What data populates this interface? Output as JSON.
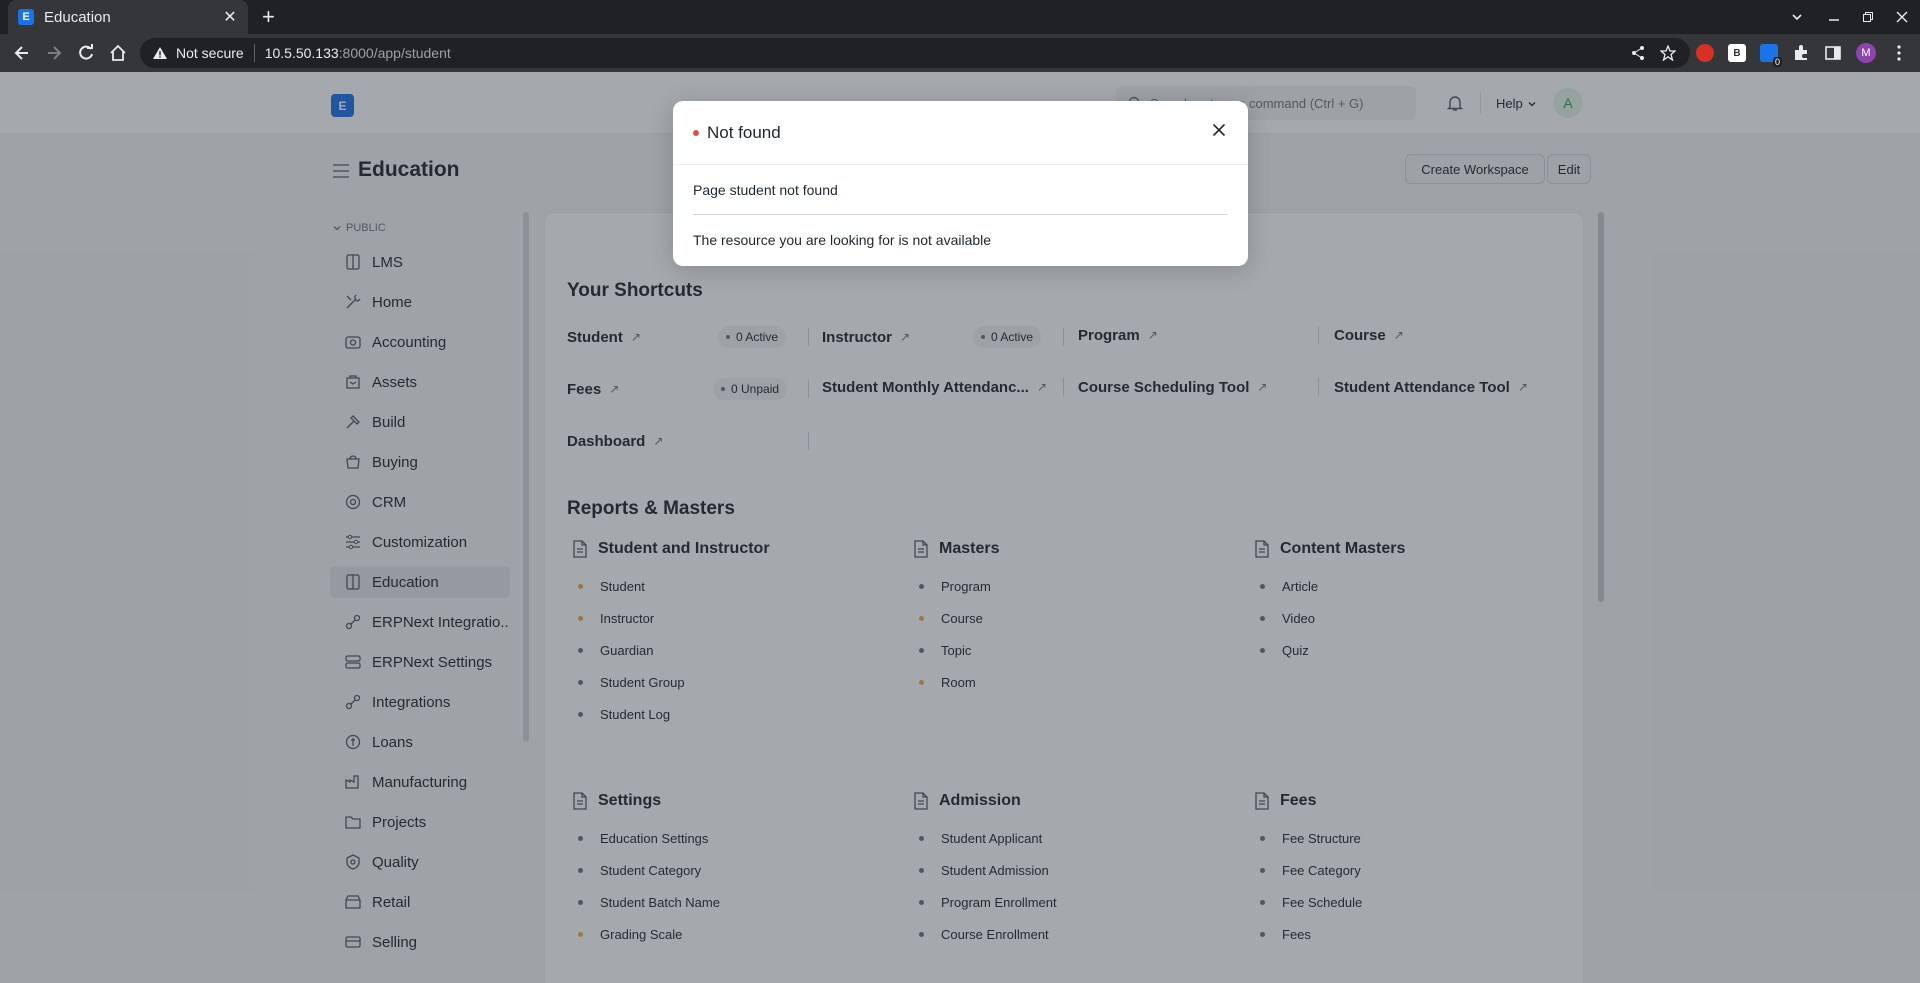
{
  "browser": {
    "tab_title": "Education",
    "tab_favicon": "E",
    "security_label": "Not secure",
    "url_host": "10.5.50.133",
    "url_rest": ":8000/app/student",
    "profile_initial": "M",
    "ext_badge": "0"
  },
  "navbar": {
    "logo": "E",
    "search_placeholder": "Search or type a command (Ctrl + G)",
    "help_label": "Help",
    "avatar_initial": "A"
  },
  "page": {
    "title": "Education",
    "create_workspace": "Create Workspace",
    "edit": "Edit"
  },
  "sidebar": {
    "section": "PUBLIC",
    "items": [
      {
        "label": "LMS",
        "icon": "book-icon"
      },
      {
        "label": "Home",
        "icon": "tools-icon"
      },
      {
        "label": "Accounting",
        "icon": "accounting-icon"
      },
      {
        "label": "Assets",
        "icon": "assets-icon"
      },
      {
        "label": "Build",
        "icon": "build-icon"
      },
      {
        "label": "Buying",
        "icon": "buying-icon"
      },
      {
        "label": "CRM",
        "icon": "crm-icon"
      },
      {
        "label": "Customization",
        "icon": "sliders-icon"
      },
      {
        "label": "Education",
        "icon": "book-icon"
      },
      {
        "label": "ERPNext Integratio...",
        "icon": "integration-icon"
      },
      {
        "label": "ERPNext Settings",
        "icon": "settings-icon"
      },
      {
        "label": "Integrations",
        "icon": "integration-icon"
      },
      {
        "label": "Loans",
        "icon": "loans-icon"
      },
      {
        "label": "Manufacturing",
        "icon": "factory-icon"
      },
      {
        "label": "Projects",
        "icon": "folder-icon"
      },
      {
        "label": "Quality",
        "icon": "quality-icon"
      },
      {
        "label": "Retail",
        "icon": "retail-icon"
      },
      {
        "label": "Selling",
        "icon": "selling-icon"
      }
    ]
  },
  "shortcuts": {
    "title": "Your Shortcuts",
    "items": [
      {
        "label": "Student",
        "pill": "0 Active"
      },
      {
        "label": "Instructor",
        "pill": "0 Active"
      },
      {
        "label": "Program",
        "pill": ""
      },
      {
        "label": "Course",
        "pill": ""
      },
      {
        "label": "Fees",
        "pill": "0 Unpaid"
      },
      {
        "label": "Student Monthly Attendanc...",
        "pill": ""
      },
      {
        "label": "Course Scheduling Tool",
        "pill": ""
      },
      {
        "label": "Student Attendance Tool",
        "pill": ""
      },
      {
        "label": "Dashboard",
        "pill": ""
      }
    ]
  },
  "reports": {
    "title": "Reports & Masters",
    "cards": [
      {
        "title": "Student and Instructor",
        "links": [
          "Student",
          "Instructor",
          "Guardian",
          "Student Group",
          "Student Log"
        ]
      },
      {
        "title": "Masters",
        "links": [
          "Program",
          "Course",
          "Topic",
          "Room"
        ]
      },
      {
        "title": "Content Masters",
        "links": [
          "Article",
          "Video",
          "Quiz"
        ]
      },
      {
        "title": "Settings",
        "links": [
          "Education Settings",
          "Student Category",
          "Student Batch Name",
          "Grading Scale"
        ]
      },
      {
        "title": "Admission",
        "links": [
          "Student Applicant",
          "Student Admission",
          "Program Enrollment",
          "Course Enrollment"
        ]
      },
      {
        "title": "Fees",
        "links": [
          "Fee Structure",
          "Fee Category",
          "Fee Schedule",
          "Fees"
        ]
      }
    ]
  },
  "modal": {
    "title": "Not found",
    "message": "Page student not found",
    "detail": "The resource you are looking for is not available"
  },
  "colors": {
    "accent": "#1a73e8",
    "error_dot": "#e24c4c",
    "warning_bullet": "#ecad4b"
  }
}
